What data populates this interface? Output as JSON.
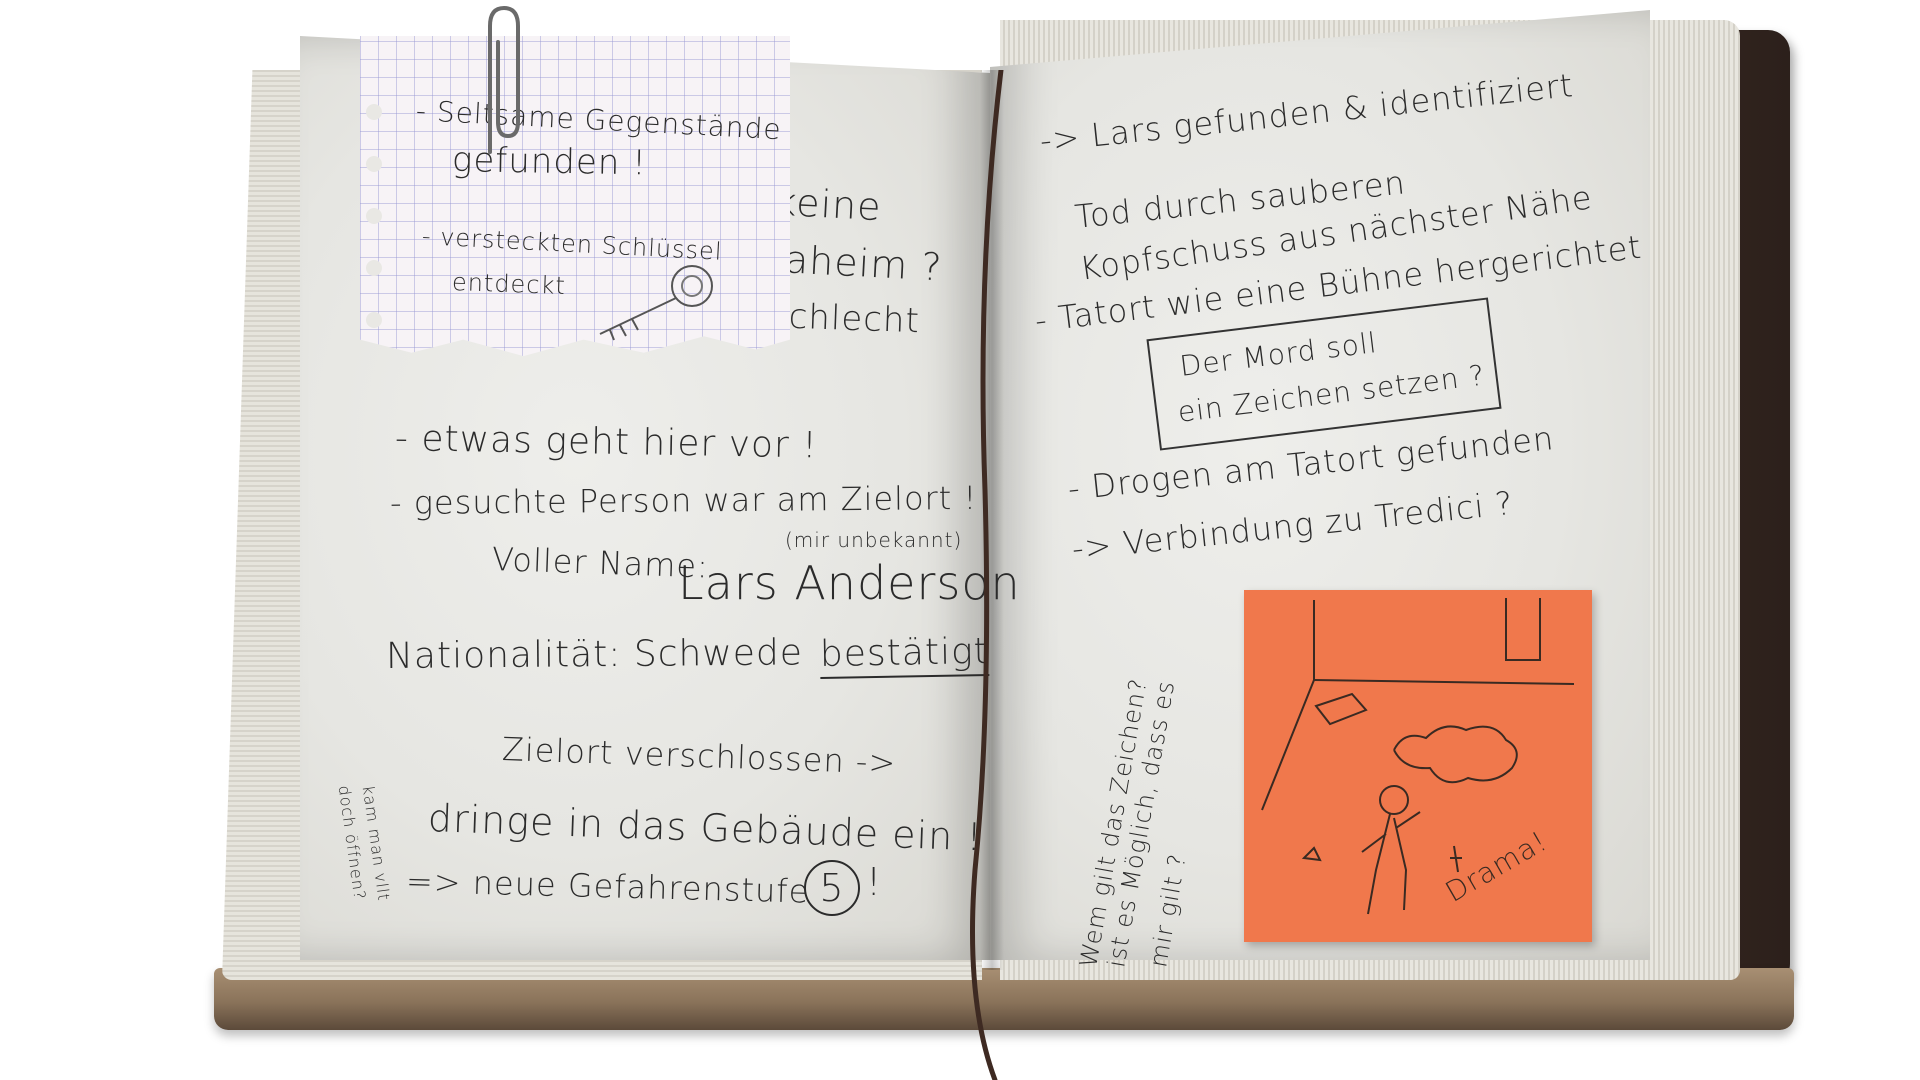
{
  "left_page": {
    "torn_line_1": "r keine",
    "torn_line_2": "daheim ?",
    "torn_line_3": "schlecht",
    "line_1": "- etwas geht hier vor !",
    "line_2": "- gesuchte Person war am Zielort !",
    "name_label": "Voller Name:",
    "name_note": "(mir unbekannt)",
    "name_value": "Lars Anderson",
    "nationality_label": "Nationalität: Schwede",
    "nationality_status": "bestätigt",
    "margin_note_1": "kam man vllt",
    "margin_note_2": "doch öffnen?",
    "line_3": "Zielort verschlossen ->",
    "line_4": "dringe in das Gebäude ein !",
    "line_5_prefix": "=> neue Gefahrenstufe",
    "danger_level": "5",
    "line_5_suffix": "!"
  },
  "grid_note": {
    "line_1": "- Seltsame Gegenstände",
    "line_2": "gefunden !",
    "line_3": "- versteckten Schlüssel",
    "line_4": "entdeckt"
  },
  "right_page": {
    "line_1": "-> Lars gefunden & identifiziert",
    "line_2": "Tod durch sauberen",
    "line_3": "Kopfschuss aus nächster Nähe",
    "line_4": "- Tatort wie eine Bühne hergerichtet",
    "boxed_1": "Der Mord soll",
    "boxed_2": "ein Zeichen setzen ?",
    "line_5": "- Drogen am Tatort gefunden",
    "line_6": "-> Verbindung zu Tredici ?",
    "vertical_1": "Wem gilt das Zeichen?",
    "vertical_2": "ist es Möglich, dass es",
    "vertical_3": "mir gilt ?"
  },
  "sticky_note": {
    "label": "Drama!"
  },
  "colors": {
    "ink": "#2b2b2b",
    "paper": "#e6e6e2",
    "sticky": "#f0784c",
    "cover": "#3d2b24"
  }
}
